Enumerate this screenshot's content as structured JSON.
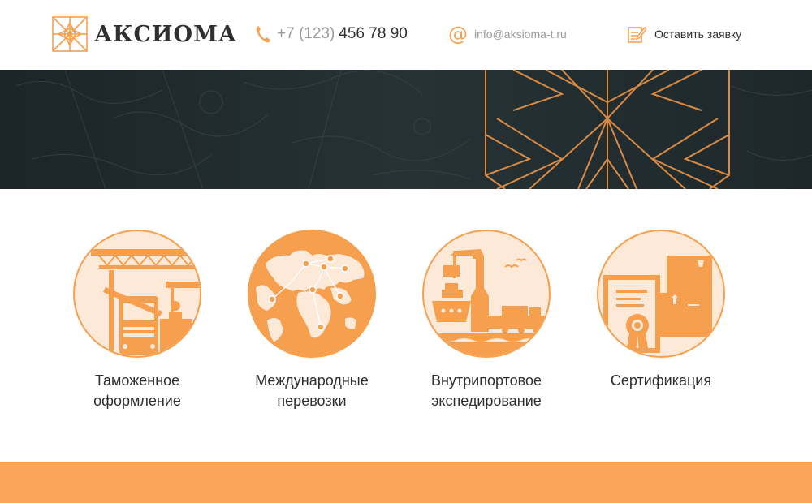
{
  "header": {
    "logo_text": "АКСИОМА",
    "phone_code": "+7 (123)",
    "phone_number": "456 78 90",
    "email": "info@aksioma-t.ru",
    "request_label": "Оставить заявку"
  },
  "services": [
    {
      "label": "Таможенное оформление",
      "icon": "customs-truck-icon"
    },
    {
      "label": "Международные перевозки",
      "icon": "world-map-icon"
    },
    {
      "label": "Внутрипортовое экспедирование",
      "icon": "port-ship-icon"
    },
    {
      "label": "Сертификация",
      "icon": "certificate-icon"
    }
  ],
  "colors": {
    "accent": "#f6a04f",
    "accent_light": "#fde9d8",
    "banner_bg": "#1f2a2d",
    "footer_band": "#f9a65a",
    "text": "#2f2f2f",
    "muted": "#9a9a9a"
  }
}
